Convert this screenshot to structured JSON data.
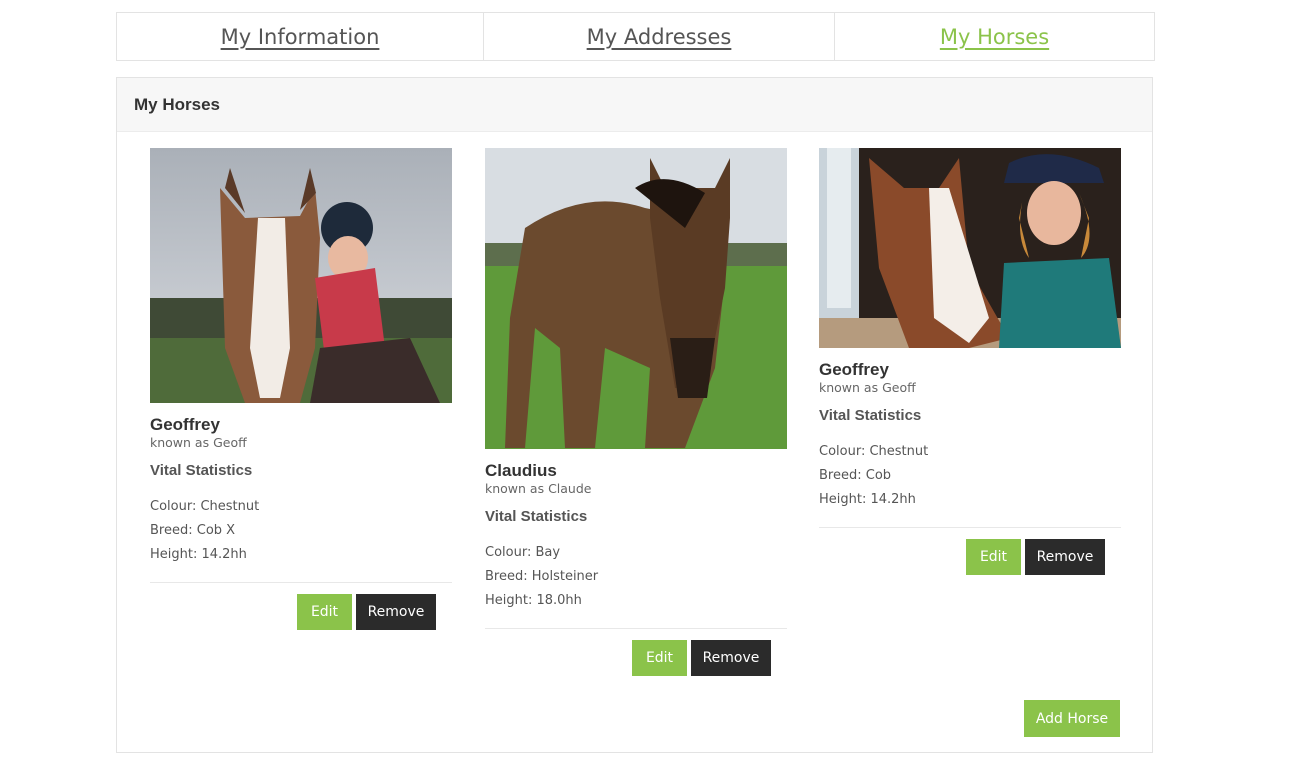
{
  "tabs": [
    {
      "label": "My Information"
    },
    {
      "label": "My Addresses"
    },
    {
      "label": "My Horses"
    }
  ],
  "panel": {
    "title": "My Horses",
    "add_button": "Add Horse"
  },
  "horses": [
    {
      "name": "Geoffrey",
      "known_as": "known as Geoff",
      "vital_title": "Vital Statistics",
      "colour": "Colour: Chestnut",
      "breed": "Breed: Cob X",
      "height": "Height: 14.2hh",
      "edit_label": "Edit",
      "remove_label": "Remove"
    },
    {
      "name": "Claudius",
      "known_as": "known as Claude",
      "vital_title": "Vital Statistics",
      "colour": "Colour: Bay",
      "breed": "Breed: Holsteiner",
      "height": "Height: 18.0hh",
      "edit_label": "Edit",
      "remove_label": "Remove"
    },
    {
      "name": "Geoffrey",
      "known_as": "known as Geoff",
      "vital_title": "Vital Statistics",
      "colour": "Colour: Chestnut",
      "breed": "Breed: Cob",
      "height": "Height: 14.2hh",
      "edit_label": "Edit",
      "remove_label": "Remove"
    }
  ],
  "colors": {
    "accent": "#8bc34a",
    "dark_button": "#2b2b2b"
  }
}
